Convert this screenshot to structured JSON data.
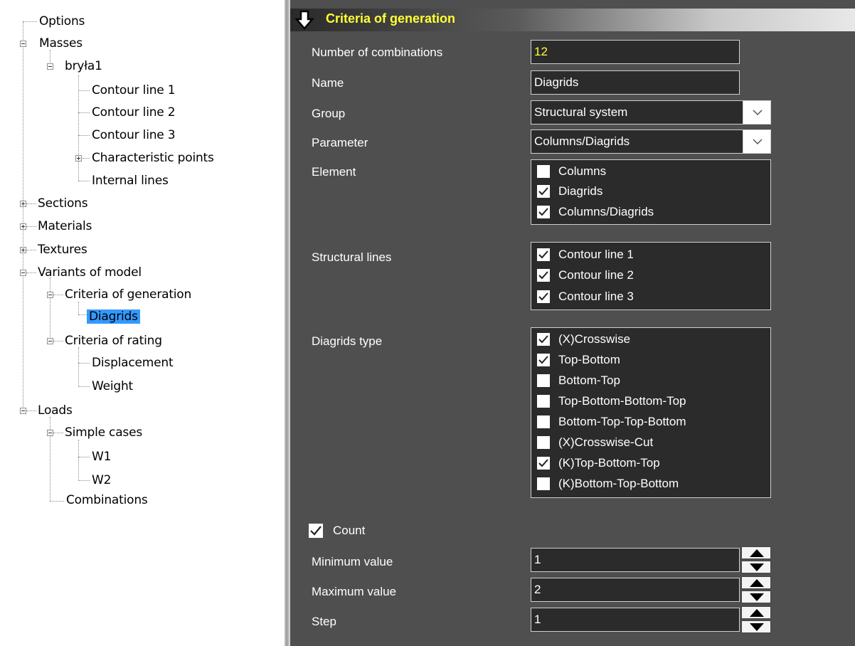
{
  "tree": {
    "nodes": [
      {
        "label": "Options"
      },
      {
        "label": "Masses"
      },
      {
        "label": "bryła1"
      },
      {
        "label": "Contour line 1"
      },
      {
        "label": "Contour line 2"
      },
      {
        "label": "Contour line 3"
      },
      {
        "label": "Characteristic points"
      },
      {
        "label": "Internal lines"
      },
      {
        "label": "Sections"
      },
      {
        "label": "Materials"
      },
      {
        "label": "Textures"
      },
      {
        "label": "Variants of model"
      },
      {
        "label": "Criteria of generation"
      },
      {
        "label": "Diagrids"
      },
      {
        "label": "Criteria of rating"
      },
      {
        "label": "Displacement"
      },
      {
        "label": "Weight"
      },
      {
        "label": "Loads"
      },
      {
        "label": "Simple cases"
      },
      {
        "label": "W1"
      },
      {
        "label": "W2"
      },
      {
        "label": "Combinations"
      }
    ],
    "selected": "Diagrids"
  },
  "panel": {
    "title": "Criteria of generation",
    "icon": "down-arrow-icon",
    "colors": {
      "title": "#ffff33",
      "background": "#4f4f4f",
      "field": "#2b2b2b",
      "selection": "#3399ff"
    },
    "fields": {
      "num_comb_label": "Number of combinations",
      "num_comb_value": "12",
      "name_label": "Name",
      "name_value": "Diagrids",
      "group_label": "Group",
      "group_value": "Structural system",
      "param_label": "Parameter",
      "param_value": "Columns/Diagrids",
      "element_label": "Element",
      "structural_label": "Structural lines",
      "diagrids_type_label": "Diagrids type",
      "count_label": "Count",
      "min_label": "Minimum value",
      "min_value": "1",
      "max_label": "Maximum value",
      "max_value": "2",
      "step_label": "Step",
      "step_value": "1"
    },
    "count_checked": true,
    "element_items": [
      {
        "label": "Columns",
        "checked": false
      },
      {
        "label": "Diagrids",
        "checked": true
      },
      {
        "label": "Columns/Diagrids",
        "checked": true
      }
    ],
    "structural_items": [
      {
        "label": "Contour line 1",
        "checked": true
      },
      {
        "label": "Contour line 2",
        "checked": true
      },
      {
        "label": "Contour line 3",
        "checked": true
      }
    ],
    "diagrids_items": [
      {
        "label": "(X)Crosswise",
        "checked": true
      },
      {
        "label": "Top-Bottom",
        "checked": true
      },
      {
        "label": "Bottom-Top",
        "checked": false
      },
      {
        "label": "Top-Bottom-Bottom-Top",
        "checked": false
      },
      {
        "label": "Bottom-Top-Top-Bottom",
        "checked": false
      },
      {
        "label": "(X)Crosswise-Cut",
        "checked": false
      },
      {
        "label": "(K)Top-Bottom-Top",
        "checked": true
      },
      {
        "label": "(K)Bottom-Top-Bottom",
        "checked": false
      }
    ]
  }
}
